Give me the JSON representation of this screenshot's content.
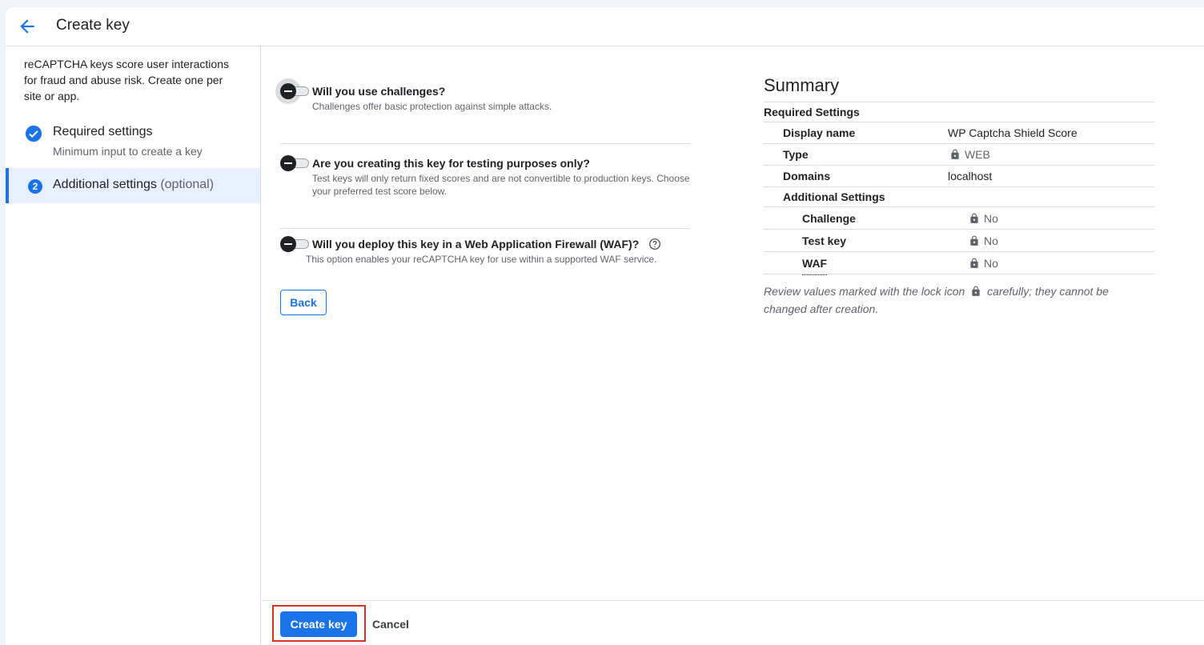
{
  "header": {
    "title": "Create key"
  },
  "sidebar": {
    "intro": "reCAPTCHA keys score user interactions for fraud and abuse risk. Create one per site or app.",
    "steps": [
      {
        "number": "1",
        "title": "Required settings",
        "subtitle": "Minimum input to create a key",
        "status": "complete"
      },
      {
        "number": "2",
        "title": "Additional settings",
        "optional": "(optional)",
        "status": "active"
      }
    ]
  },
  "questions": [
    {
      "title": "Will you use challenges?",
      "description": "Challenges offer basic protection against simple attacks.",
      "enabled": false
    },
    {
      "title": "Are you creating this key for testing purposes only?",
      "description": "Test keys will only return fixed scores and are not convertible to production keys. Choose your preferred test score below.",
      "enabled": false
    },
    {
      "title": "Will you deploy this key in a Web Application Firewall (WAF)?",
      "description": "This option enables your reCAPTCHA key for use within a supported WAF service.",
      "enabled": false
    }
  ],
  "back_label": "Back",
  "summary": {
    "title": "Summary",
    "required_header": "Required Settings",
    "display_name_label": "Display name",
    "display_name_value": "WP Captcha Shield Score",
    "type_label": "Type",
    "type_value": "WEB",
    "domains_label": "Domains",
    "domains_value": "localhost",
    "additional_header": "Additional Settings",
    "challenge_label": "Challenge",
    "challenge_value": "No",
    "test_key_label": "Test key",
    "test_key_value": "No",
    "waf_label": "WAF",
    "waf_value": "No",
    "note_before": "Review values marked with the lock icon",
    "note_after": "carefully; they cannot be changed after creation."
  },
  "footer": {
    "create_label": "Create key",
    "cancel_label": "Cancel"
  },
  "colors": {
    "accent": "#1a73e8",
    "highlight": "#d93025",
    "active_step_bg": "#e8f0fe"
  }
}
